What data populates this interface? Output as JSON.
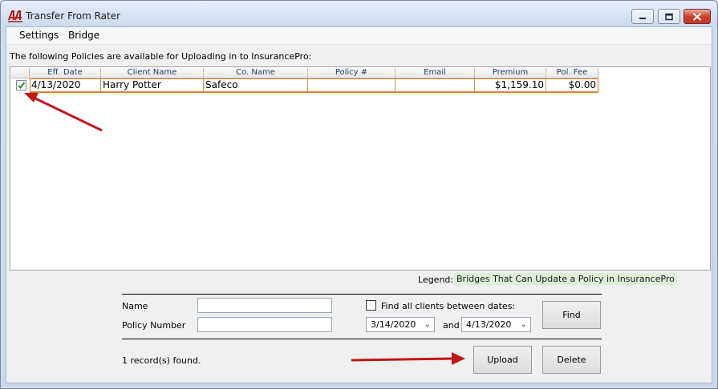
{
  "window": {
    "title": "Transfer From Rater"
  },
  "menu": {
    "settings": "Settings",
    "bridge": "Bridge"
  },
  "instructions": "The following Policies are available for Uploading in to InsurancePro:",
  "grid": {
    "columns": [
      "Eff. Date",
      "Client Name",
      "Co. Name",
      "Policy #",
      "Email",
      "Premium",
      "Pol. Fee"
    ],
    "rows": [
      {
        "selected": true,
        "eff_date": "4/13/2020",
        "client_name": "Harry Potter",
        "co_name": "Safeco",
        "policy_no": "",
        "email": "",
        "premium": "$1,159.10",
        "pol_fee": "$0.00"
      }
    ]
  },
  "legend": {
    "label": "Legend:",
    "value": "Bridges That Can Update a Policy in InsurancePro"
  },
  "search": {
    "name_label": "Name",
    "name_value": "",
    "policy_label": "Policy Number",
    "policy_value": "",
    "date_filter_label": "Find all clients between dates:",
    "date_filter_checked": false,
    "date_from": "3/14/2020",
    "and_label": "and",
    "date_to": "4/13/2020",
    "find_button": "Find"
  },
  "status": "1 record(s) found.",
  "actions": {
    "upload": "Upload",
    "delete": "Delete"
  },
  "colors": {
    "accent_arrow": "#c0161b",
    "row_border": "#e07a1a",
    "legend_bg": "#dcefd6",
    "close_button": "#c0392b"
  }
}
